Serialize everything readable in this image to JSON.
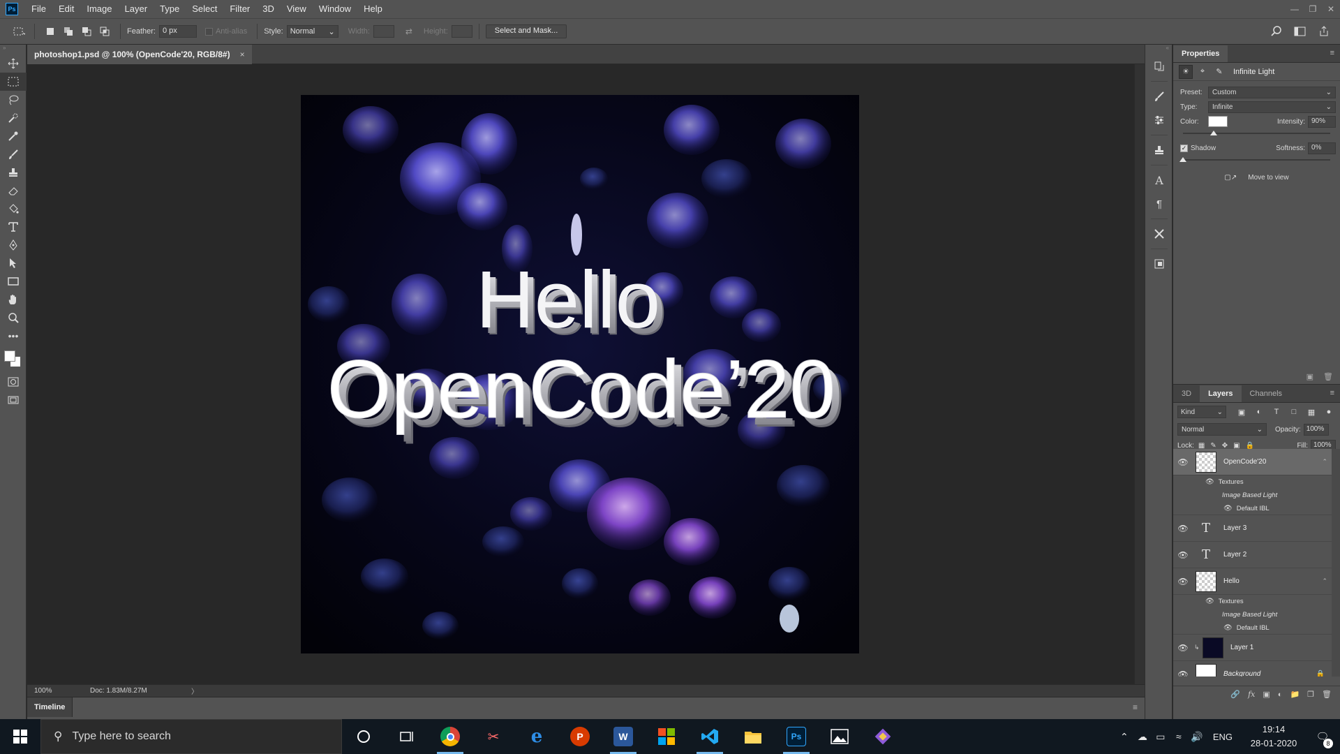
{
  "app": {
    "logo": "Ps"
  },
  "menubar": {
    "items": [
      "File",
      "Edit",
      "Image",
      "Layer",
      "Type",
      "Select",
      "Filter",
      "3D",
      "View",
      "Window",
      "Help"
    ]
  },
  "options": {
    "feather_label": "Feather:",
    "feather_value": "0 px",
    "antialias_label": "Anti-alias",
    "style_label": "Style:",
    "style_value": "Normal",
    "width_label": "Width:",
    "height_label": "Height:",
    "select_mask_label": "Select and Mask..."
  },
  "document": {
    "tab_title": "photoshop1.psd @ 100% (OpenCode'20, RGB/8#)",
    "close_glyph": "×",
    "zoom": "100%",
    "doc_size": "Doc: 1.83M/8.27M",
    "status_arrow": "〉"
  },
  "canvas": {
    "line1": "Hello",
    "line2": "OpenCode’20"
  },
  "timeline": {
    "label": "Timeline"
  },
  "properties": {
    "tab": "Properties",
    "title": "Infinite Light",
    "preset_label": "Preset:",
    "preset_value": "Custom",
    "type_label": "Type:",
    "type_value": "Infinite",
    "color_label": "Color:",
    "intensity_label": "Intensity:",
    "intensity_value": "90%",
    "shadow_label": "Shadow",
    "softness_label": "Softness:",
    "softness_value": "0%",
    "move_to_view": "Move to view",
    "intensity_fraction": 0.9,
    "softness_fraction": 0.0
  },
  "layers_panel": {
    "tabs": [
      "3D",
      "Layers",
      "Channels"
    ],
    "kind_label": "Kind",
    "blend_mode": "Normal",
    "opacity_label": "Opacity:",
    "opacity_value": "100%",
    "lock_label": "Lock:",
    "fill_label": "Fill:",
    "fill_value": "100%",
    "layers": [
      {
        "name": "OpenCode'20",
        "kind": "3d",
        "sub": [
          "Textures",
          "Image Based Light",
          "Default IBL"
        ]
      },
      {
        "name": "Layer 3",
        "kind": "text"
      },
      {
        "name": "Layer 2",
        "kind": "text"
      },
      {
        "name": "Hello",
        "kind": "3d",
        "sub": [
          "Textures",
          "Image Based Light",
          "Default IBL"
        ]
      },
      {
        "name": "Layer 1",
        "kind": "image"
      },
      {
        "name": "Background",
        "kind": "background"
      }
    ]
  },
  "taskbar": {
    "search_placeholder": "Type here to search",
    "lang": "ENG",
    "time": "19:14",
    "date": "28-01-2020",
    "notification_count": "8"
  }
}
